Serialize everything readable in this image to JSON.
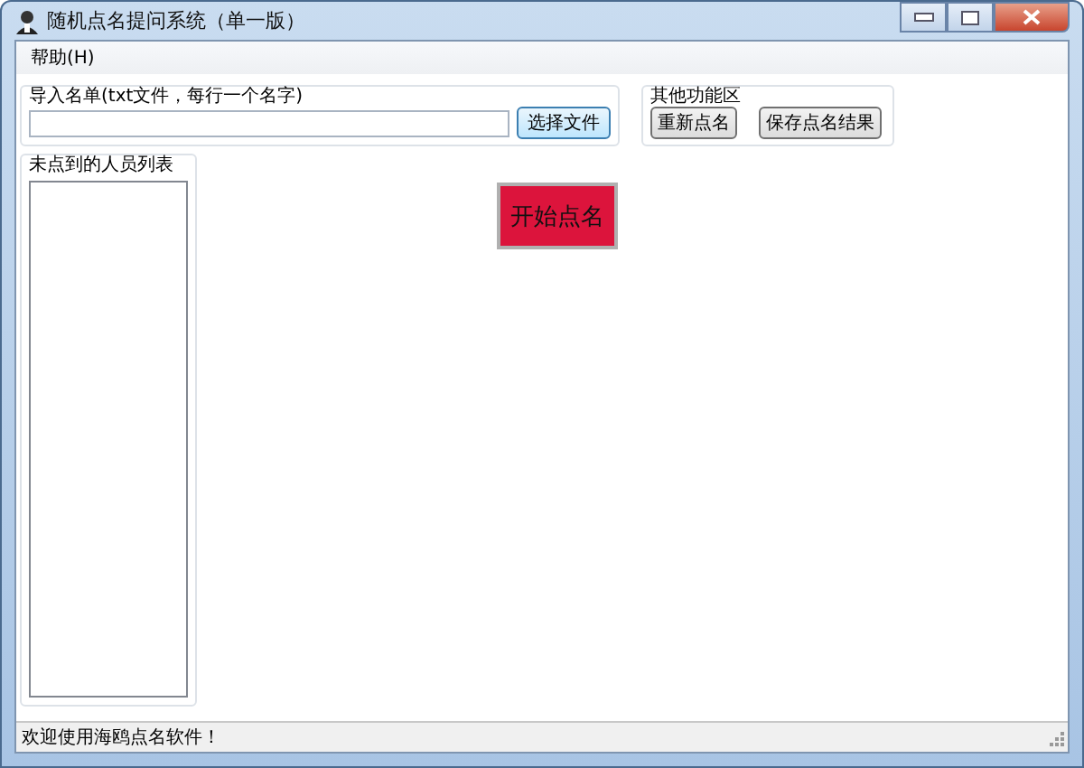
{
  "window": {
    "title": "随机点名提问系统（单一版）"
  },
  "menu": [
    {
      "label": "帮助(H)"
    }
  ],
  "import_group": {
    "title": "导入名单(txt文件，每行一个名字)",
    "button": "选择文件"
  },
  "other_group": {
    "title": "其他功能区",
    "buttons": [
      "重新点名",
      "保存点名结果"
    ]
  },
  "absent_group": {
    "title": "未点到的人员列表"
  },
  "start_button": "开始点名",
  "status_bar": "欢迎使用海鸥点名软件！"
}
